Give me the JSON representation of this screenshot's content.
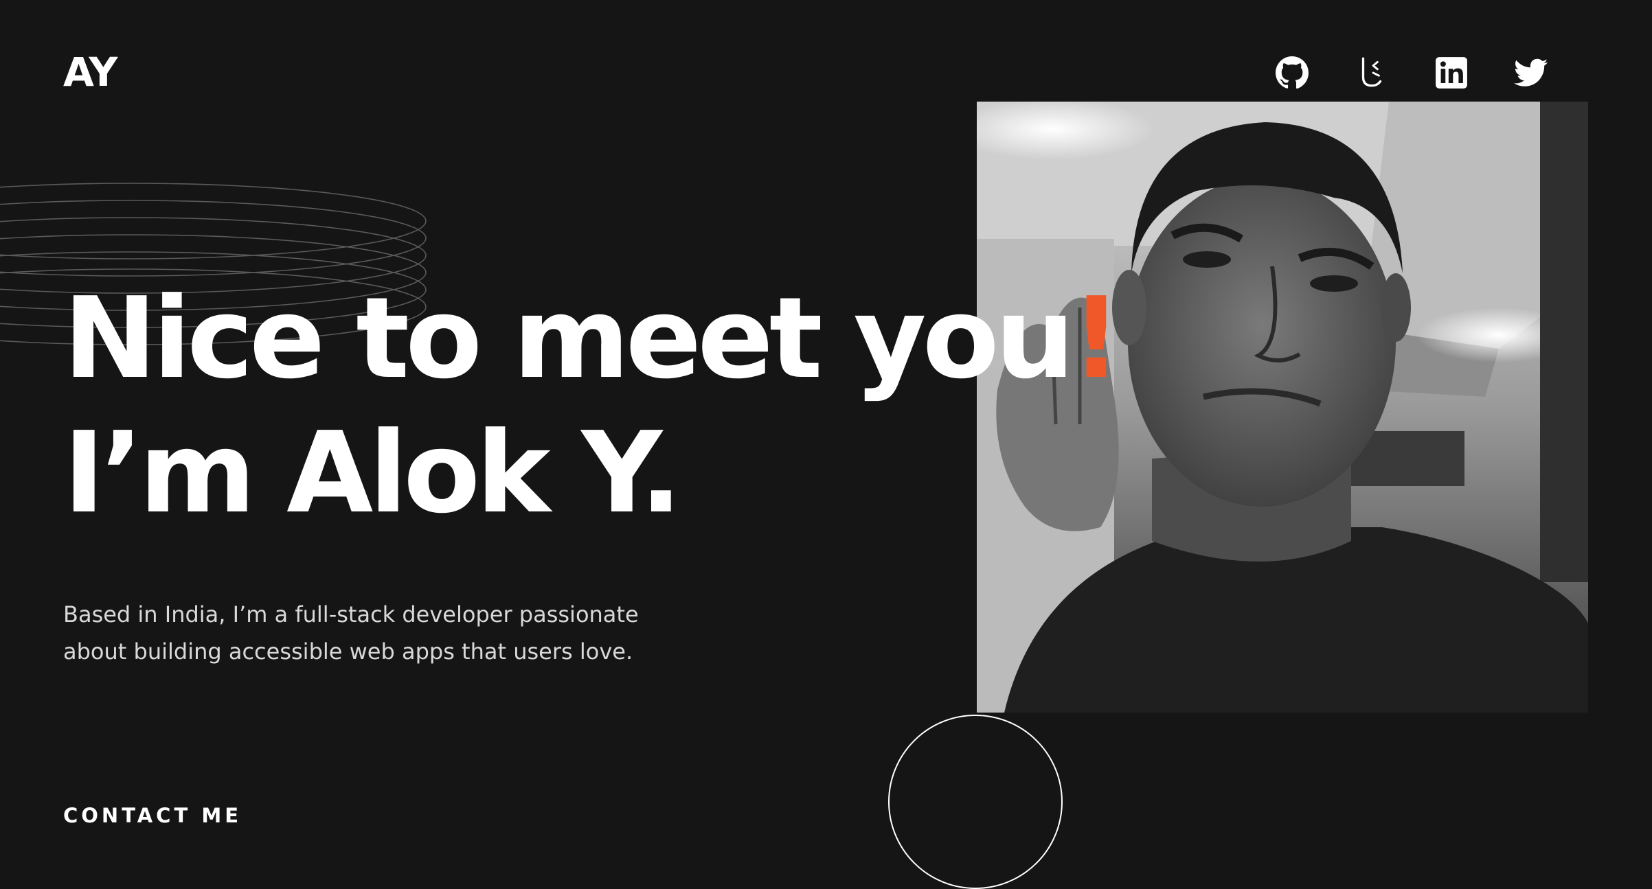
{
  "header": {
    "logo": "AY",
    "socials": [
      {
        "icon": "github-icon"
      },
      {
        "icon": "kaggle-like-icon"
      },
      {
        "icon": "linkedin-icon"
      },
      {
        "icon": "twitter-icon"
      }
    ]
  },
  "hero": {
    "headline_line1_main": "Nice to meet you",
    "headline_line1_excl": "!",
    "headline_line2": "I’m Alok Y.",
    "bio": "Based in India, I’m a full-stack developer passionate about building accessible web apps that users love.",
    "contact_label": "CONTACT ME"
  },
  "colors": {
    "background": "#151515",
    "accent": "#f0582a",
    "text": "#ffffff"
  }
}
